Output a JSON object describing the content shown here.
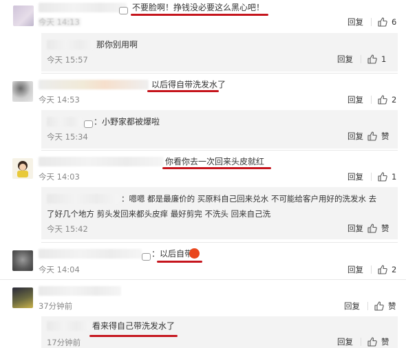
{
  "comments": [
    {
      "text": "不要脸啊！挣钱没必要这么黑心吧！",
      "time": "今天 14:13",
      "reply": "回复",
      "likes": "6"
    },
    {
      "text": "那你别用啊",
      "time": "今天 15:57",
      "reply": "回复",
      "likes": "1"
    },
    {
      "text": "以后得自带洗发水了",
      "time": "今天 14:53",
      "reply": "回复",
      "likes": "2"
    },
    {
      "text": "：小野家都被爆啦",
      "time": "今天 15:34",
      "reply": "回复",
      "likes": "赞"
    },
    {
      "text": "你看你去一次回来头皮就红",
      "time": "今天 14:03",
      "reply": "回复",
      "likes": "1"
    },
    {
      "text_line1": "：嗯嗯 都是最廉价的 买原料自己回来兑水 不可能给客户用好的洗发水 去",
      "text_line2": "了好几个地方 剪头发回来都头皮痒 最好剪完 不洗头 回来自己洗",
      "time": "今天 15:42",
      "reply": "回复",
      "likes": "赞"
    },
    {
      "text": "：以后自带",
      "time": "今天 14:04",
      "reply": "回复",
      "likes": "2"
    },
    {
      "text": "",
      "time": "37分钟前",
      "reply": "回复",
      "likes": "赞"
    },
    {
      "text": "看来得自己带洗发水了",
      "time": "17分钟前",
      "reply": "回复",
      "likes": "赞"
    }
  ],
  "colors": {
    "highlight": "#c5141c",
    "subbox": "#f3f3f3",
    "time": "#888888"
  },
  "icons": {
    "like": "thumbs-up-icon"
  }
}
